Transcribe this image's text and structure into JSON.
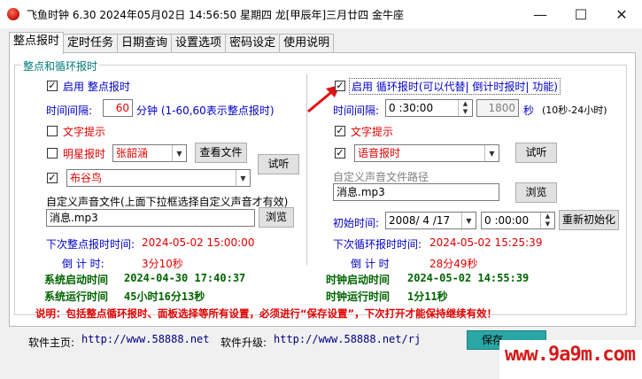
{
  "window": {
    "title": "飞鱼时钟 6.30 2024年05月02日 14:56:50 星期四 龙[甲辰年]三月廿四 金牛座",
    "minimize": "—",
    "maximize": "☐",
    "close": "✕"
  },
  "tabs": [
    "整点报时",
    "定时任务",
    "日期查询",
    "设置选项",
    "密码设定",
    "使用说明"
  ],
  "group_title": "整点和循环报时",
  "left": {
    "enable_label": "启用 整点报时",
    "enable_checked": "✓",
    "interval_label": "时间间隔:",
    "interval_value": "60",
    "interval_unit": "分钟 (1-60,60表示整点报时)",
    "text_tip_label": "文字提示",
    "star_label": "明星报时",
    "star_value": "张韶涵",
    "view_file_button": "查看文件",
    "listen_button": "试听",
    "sound_checked": "✓",
    "sound_value": "布谷鸟",
    "custom_label": "自定义声音文件(上面下拉框选择自定义声音才有效)",
    "custom_value": "消息.mp3",
    "browse_button": "浏览",
    "next_label": "下次整点报时时间:",
    "next_value": "2024-05-02 15:00:00",
    "countdown_label": "倒 计 时:",
    "countdown_value": "3分10秒",
    "sys_start_label": "系统启动时间",
    "sys_start_value": "2024-04-30 17:40:37",
    "sys_run_label": "系统运行时间",
    "sys_run_value": "45小时16分13秒"
  },
  "right": {
    "enable_label": "启用 循环报时(可以代替| 倒计时报时| 功能)",
    "enable_checked": "✓",
    "interval_label": "时间间隔:",
    "interval_value": "0 :30:00",
    "seconds_value": "1800",
    "seconds_unit": "秒",
    "range_note": "(10秒-24小时)",
    "text_tip_checked": "✓",
    "text_tip_label": "文字提示",
    "voice_checked": "✓",
    "voice_value": "语音报时",
    "listen_button": "试听",
    "custom_path_label": "自定义声音文件路径",
    "custom_value": "消息.mp3",
    "browse_button": "浏览",
    "init_label": "初始时间:",
    "init_date": "2008/ 4 /17",
    "init_time": "0 :00:00",
    "reinit_button": "重新初始化",
    "next_label": "下次循环报时时间:",
    "next_value": "2024-05-02 15:25:39",
    "countdown_label": "倒 计 时",
    "countdown_value": "28分49秒",
    "clock_start_label": "时钟启动时间",
    "clock_start_value": "2024-05-02 14:55:39",
    "clock_run_label": "时钟运行时间",
    "clock_run_value": "1分11秒"
  },
  "note": "说明：包括整点循环报时、面板选择等所有设置，必须进行“保存设置”，下次打开才能保持继续有效！",
  "footer": {
    "home_label": "软件主页:",
    "home_url": "http://www.58888.net",
    "upgrade_label": "软件升级:",
    "upgrade_url": "http://www.58888.net/rj",
    "save_button": "保存"
  },
  "watermark": "www.9a9m.com",
  "colors": {
    "accent_teal": "#2aa6a6",
    "label_blue": "#0000c8",
    "value_red": "#e00000",
    "status_green": "#006400",
    "arrow_red": "#e01010"
  }
}
